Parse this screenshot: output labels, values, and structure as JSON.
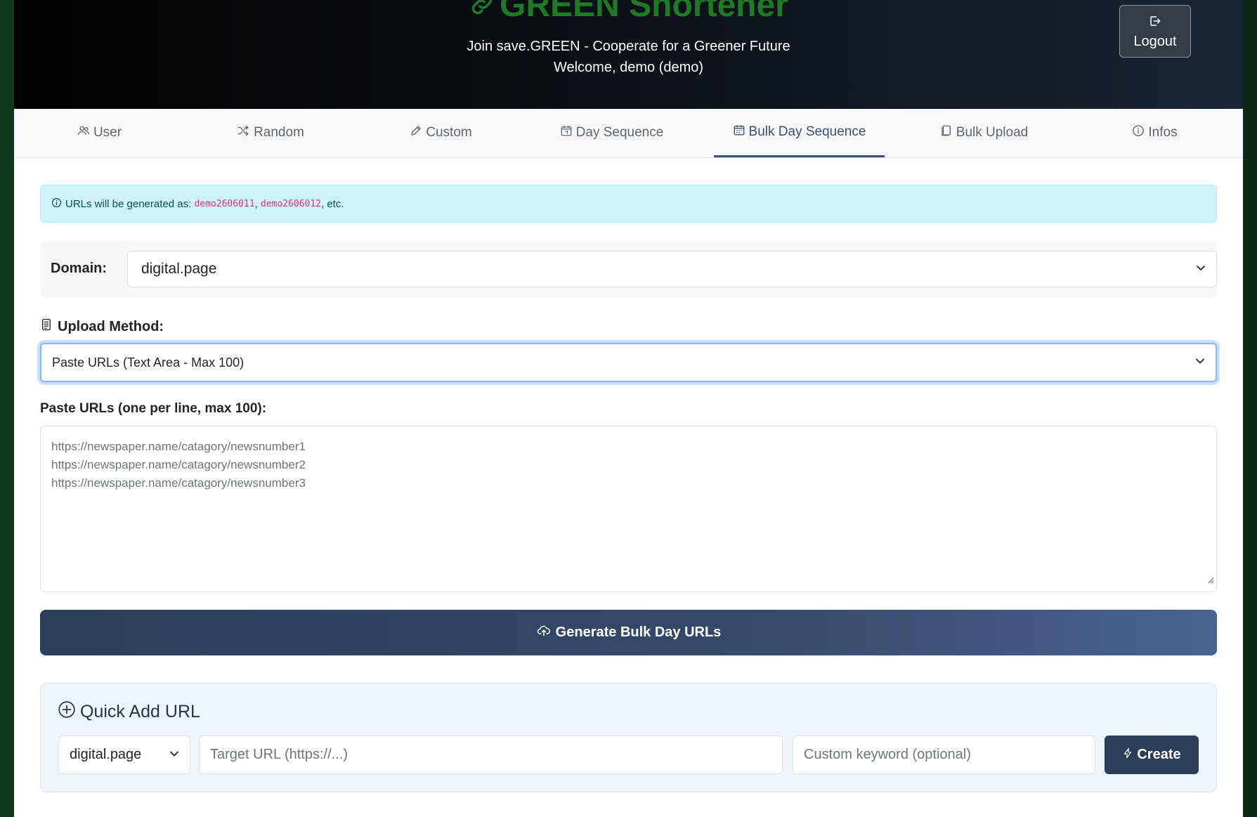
{
  "header": {
    "brand": "GREEN Shortener",
    "tagline": "Join save.GREEN - Cooperate for a Greener Future",
    "welcome": "Welcome, demo (demo)",
    "logout_label": "Logout"
  },
  "tabs": [
    {
      "label": "User",
      "icon": "users-icon"
    },
    {
      "label": "Random",
      "icon": "shuffle-icon"
    },
    {
      "label": "Custom",
      "icon": "pencil-icon"
    },
    {
      "label": "Day Sequence",
      "icon": "calendar-day-icon"
    },
    {
      "label": "Bulk Day Sequence",
      "icon": "calendar-week-icon",
      "active": true
    },
    {
      "label": "Bulk Upload",
      "icon": "files-icon"
    },
    {
      "label": "Infos",
      "icon": "info-circle-icon"
    }
  ],
  "alert": {
    "prefix": "URLs will be generated as:",
    "example1": "demo2606011",
    "sep": ",",
    "example2": "demo2606012",
    "suffix": ", etc."
  },
  "domain": {
    "label": "Domain:",
    "selected": "digital.page"
  },
  "upload": {
    "label": "Upload Method:",
    "selected": "Paste URLs (Text Area - Max 100)"
  },
  "paste": {
    "label": "Paste URLs (one per line, max 100):",
    "lines": [
      "https://newspaper.name/catagory/newsnumber1",
      "https://newspaper.name/catagory/newsnumber2",
      "https://newspaper.name/catagory/newsnumber3"
    ]
  },
  "generate": {
    "label": "Generate Bulk Day URLs"
  },
  "quick_add": {
    "title": "Quick Add URL",
    "domain": "digital.page",
    "target_placeholder": "Target URL (https://...)",
    "keyword_placeholder": "Custom keyword (optional)",
    "create_label": "Create"
  },
  "colors": {
    "brand": "#1f7a26",
    "accent": "#3b4f73",
    "alert_bg": "#cff4fc",
    "button_dark": "#2c3e57"
  }
}
